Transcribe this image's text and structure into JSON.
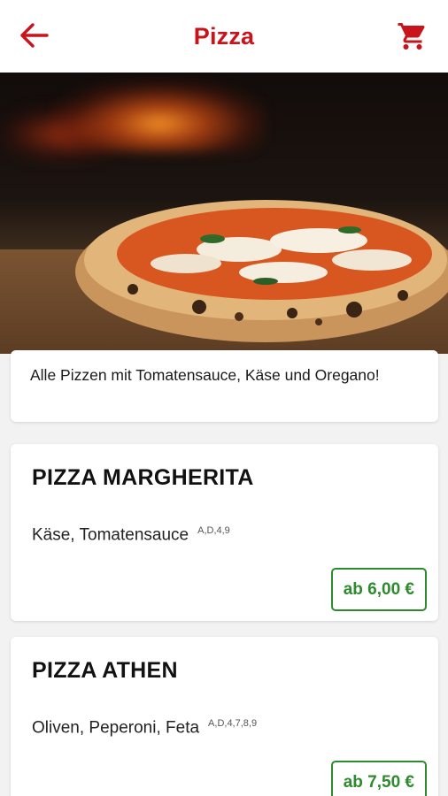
{
  "header": {
    "title": "Pizza",
    "back_icon": "arrow-left-icon",
    "cart_icon": "shopping-cart-icon",
    "accent_color": "#c8141b"
  },
  "info": {
    "text": "Alle Pizzen mit Tomatensauce, Käse und Oregano!"
  },
  "items": [
    {
      "name": "PIZZA MARGHERITA",
      "description": "Käse, Tomatensauce",
      "allergens": "A,D,4,9",
      "price": "ab 6,00 €"
    },
    {
      "name": "PIZZA ATHEN",
      "description": "Oliven, Peperoni, Feta",
      "allergens": "A,D,4,7,8,9",
      "price": "ab 7,50 €"
    }
  ],
  "colors": {
    "price_green": "#2d8a2d",
    "background": "#f2f2f2"
  }
}
